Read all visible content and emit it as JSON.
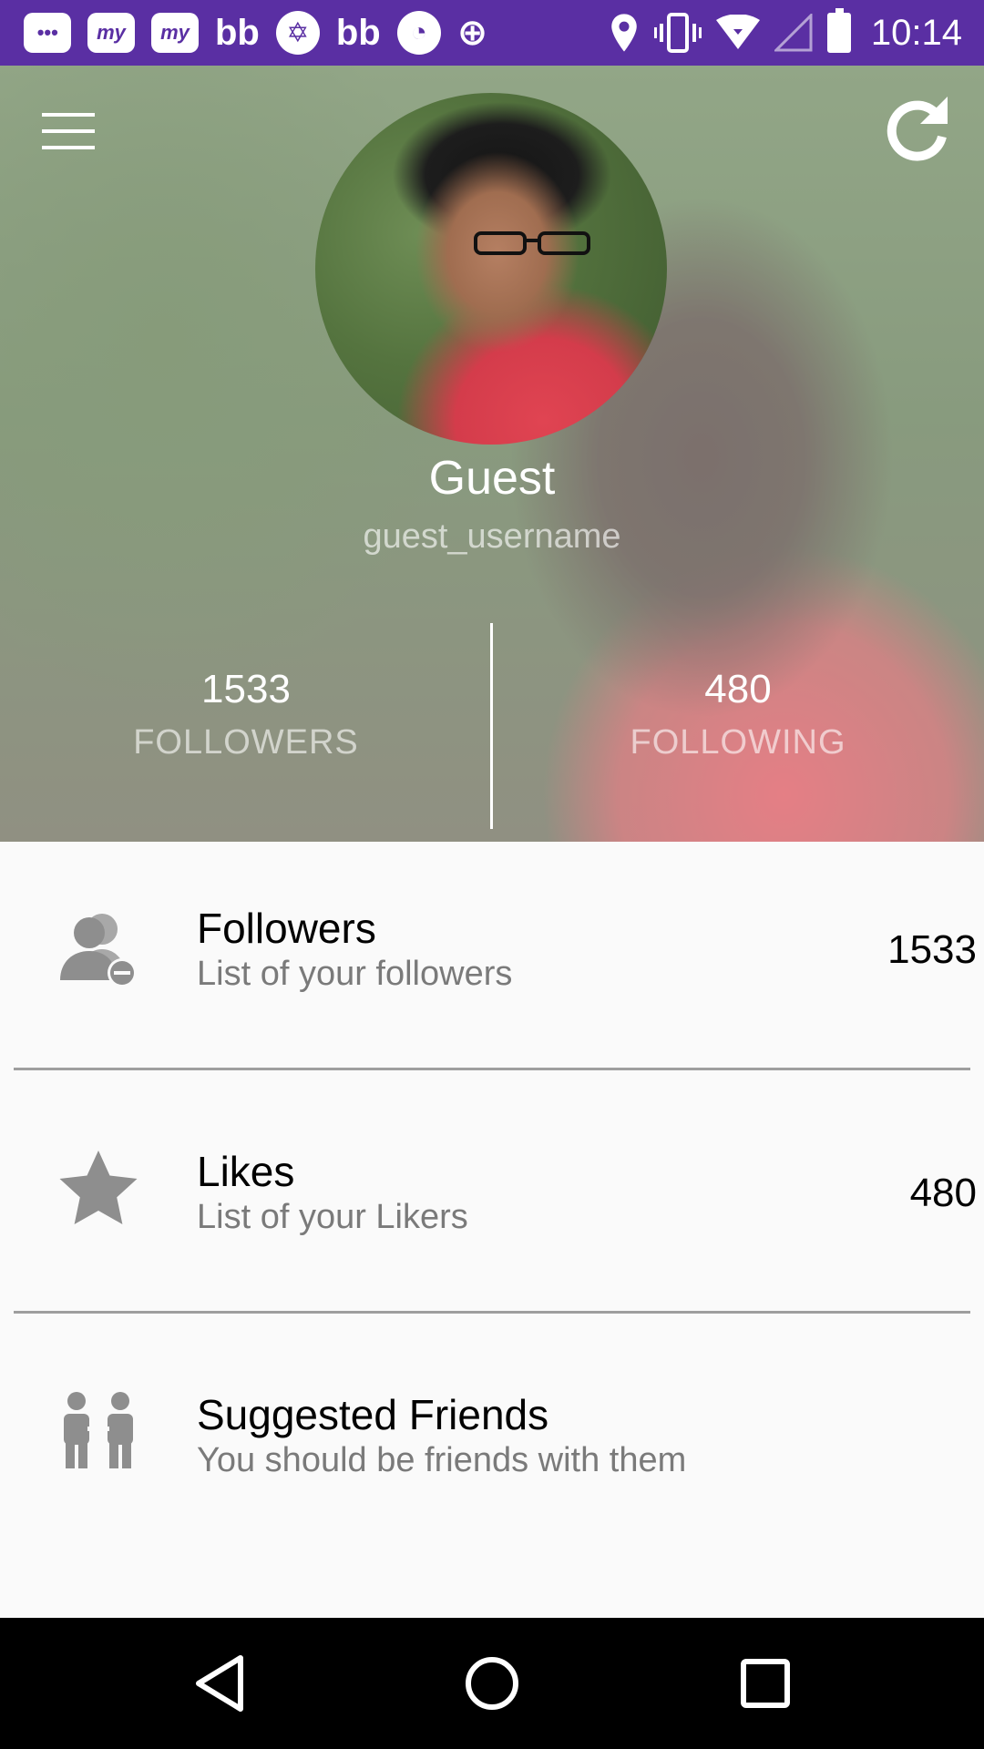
{
  "status_bar": {
    "time": "10:14",
    "app_icons": [
      "messages-icon",
      "myntra-icon",
      "myntra-icon",
      "bb-icon",
      "star-app-icon",
      "bb-icon",
      "whatsapp-icon",
      "data-saver-icon"
    ],
    "app_labels": [
      "•••",
      "my",
      "my",
      "bb",
      "✡",
      "bb",
      "◔",
      "⊕"
    ],
    "system_icons": [
      "location-icon",
      "vibrate-icon",
      "wifi-icon",
      "signal-icon",
      "battery-icon"
    ]
  },
  "header": {
    "menu_icon": "menu-icon",
    "refresh_icon": "refresh-icon",
    "name": "Guest",
    "username": "guest_username",
    "followers_count": "1533",
    "followers_label": "FOLLOWERS",
    "following_count": "480",
    "following_label": "FOLLOWING"
  },
  "list": [
    {
      "icon": "remove-users-icon",
      "title": "Followers",
      "subtitle": "List of your followers",
      "count": "1533"
    },
    {
      "icon": "star-icon",
      "title": "Likes",
      "subtitle": "List of your Likers",
      "count": "480"
    },
    {
      "icon": "suggested-friends-icon",
      "title": "Suggested Friends",
      "subtitle": "You should be friends with them",
      "count": ""
    }
  ],
  "nav_bar": {
    "buttons": [
      "back-icon",
      "home-icon",
      "recents-icon"
    ]
  },
  "colors": {
    "status_bar": "#5a2fa3",
    "list_background": "#fafafa",
    "icon_gray": "#8e8e8e",
    "divider": "#9e9e9e"
  }
}
